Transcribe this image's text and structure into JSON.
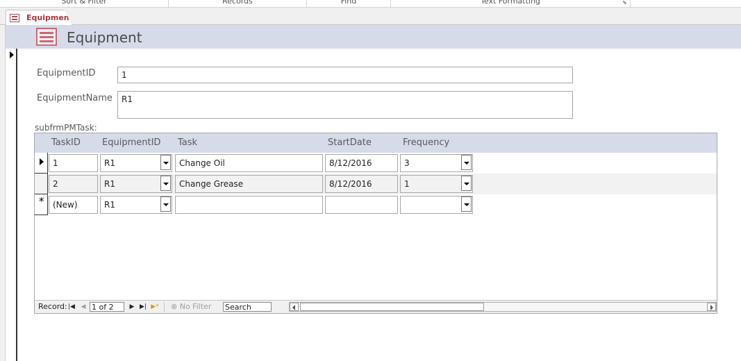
{
  "ribbon": {
    "groups": [
      "Sort & Filter",
      "Records",
      "Find",
      "Text Formatting"
    ]
  },
  "document_tab": {
    "label": "Equipment",
    "icon": "form-icon"
  },
  "form": {
    "title": "Equipment",
    "fields": [
      {
        "label": "EquipmentID",
        "value": "1"
      },
      {
        "label": "EquipmentName",
        "value": "R1"
      }
    ],
    "subform_label": "subfrmPMTask:"
  },
  "datasheet": {
    "columns": [
      "TaskID",
      "EquipmentID",
      "Task",
      "StartDate",
      "Frequency"
    ],
    "rows": [
      {
        "TaskID": "1",
        "EquipmentID": "R1",
        "Task": "Change Oil",
        "StartDate": "8/12/2016",
        "Frequency": "3",
        "selector": "current"
      },
      {
        "TaskID": "2",
        "EquipmentID": "R1",
        "Task": "Change Grease",
        "StartDate": "8/12/2016",
        "Frequency": "1",
        "selector": "none"
      },
      {
        "TaskID": "(New)",
        "EquipmentID": "R1",
        "Task": "",
        "StartDate": "",
        "Frequency": "",
        "selector": "new"
      }
    ]
  },
  "navigation": {
    "record_label": "Record:",
    "position": "1 of 2",
    "filter_label": "No Filter",
    "search_label": "Search"
  },
  "colors": {
    "header_band": "#d6dbe9",
    "tab_accent": "#a4373a"
  }
}
